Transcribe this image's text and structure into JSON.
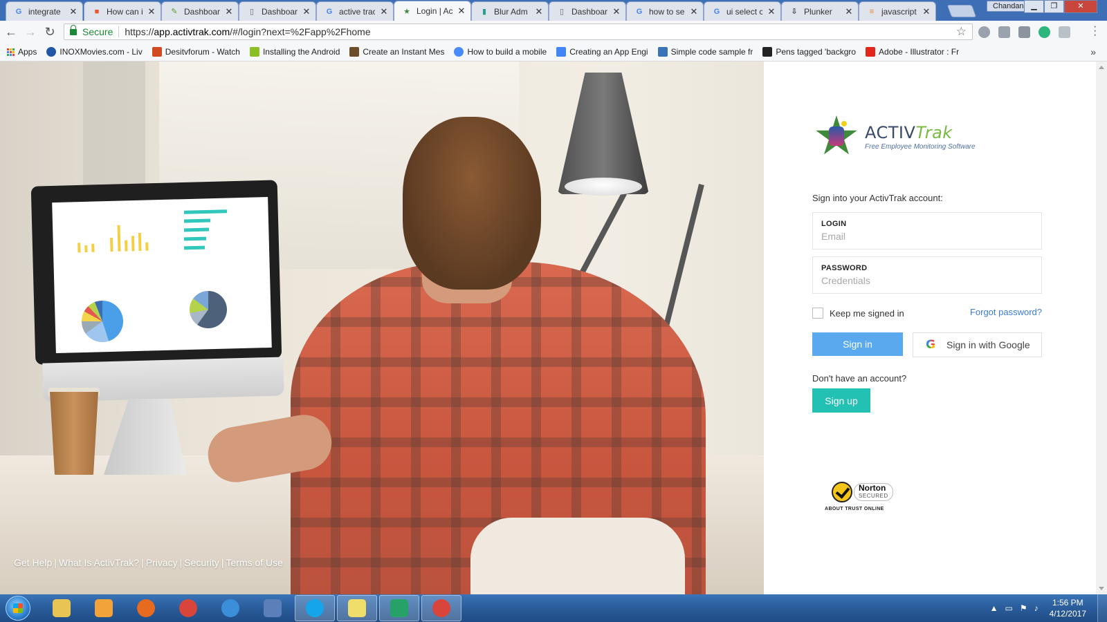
{
  "browser": {
    "tabs": [
      {
        "title": "integrate",
        "icon": "google-icon",
        "active": false
      },
      {
        "title": "How can i",
        "icon": "microsoft-icon",
        "active": false
      },
      {
        "title": "Dashboard",
        "icon": "leaf-icon",
        "active": false
      },
      {
        "title": "Dashboard",
        "icon": "page-icon",
        "active": false
      },
      {
        "title": "active trac",
        "icon": "google-icon",
        "active": false
      },
      {
        "title": "Login | Ac",
        "icon": "activtrak-icon",
        "active": true
      },
      {
        "title": "Blur Adm",
        "icon": "chart-icon",
        "active": false
      },
      {
        "title": "Dashboard",
        "icon": "page-icon",
        "active": false
      },
      {
        "title": "how to se",
        "icon": "google-icon",
        "active": false
      },
      {
        "title": "ui select c",
        "icon": "google-icon",
        "active": false
      },
      {
        "title": "Plunker",
        "icon": "plunker-icon",
        "active": false
      },
      {
        "title": "javascript",
        "icon": "stackoverflow-icon",
        "active": false
      }
    ],
    "close_glyph": "✕",
    "user": "Chandan",
    "window_controls": {
      "minimize": "▁",
      "maximize": "❐",
      "close": "✕"
    },
    "address": {
      "secure_label": "Secure",
      "url_scheme": "https://",
      "url_host": "app.activtrak.com",
      "url_path": "/#/login?next=%2Fapp%2Fhome"
    },
    "bookmarks": [
      {
        "label": "Apps",
        "icon": "apps-grid-icon"
      },
      {
        "label": "INOXMovies.com - Liv",
        "icon": "inox-icon"
      },
      {
        "label": "Desitvforum - Watch",
        "icon": "desitv-icon"
      },
      {
        "label": "Installing the Android",
        "icon": "android-icon"
      },
      {
        "label": "Create an Instant Mes",
        "icon": "bookmark-icon"
      },
      {
        "label": "How to build a mobile",
        "icon": "ionic-icon"
      },
      {
        "label": "Creating an App Engi",
        "icon": "appengine-icon"
      },
      {
        "label": "Simple code sample fr",
        "icon": "grid-icon"
      },
      {
        "label": "Pens tagged 'backgro",
        "icon": "codepen-icon"
      },
      {
        "label": "Adobe - Illustrator : Fr",
        "icon": "adobe-icon"
      }
    ],
    "bookmarks_more": "»"
  },
  "hero": {
    "footer_links": [
      "Get Help",
      "What Is ActivTrak?",
      "Privacy",
      "Security",
      "Terms of Use"
    ],
    "separator": "|"
  },
  "login": {
    "logo": {
      "word_a": "ACTIV",
      "word_b": "Trak",
      "tagline": "Free Employee  Monitoring Software"
    },
    "intro": "Sign into your ActivTrak account:",
    "login_label": "LOGIN",
    "login_placeholder": "Email",
    "password_label": "PASSWORD",
    "password_placeholder": "Credentials",
    "keep_signed_in": "Keep me signed in",
    "forgot_password": "Forgot password?",
    "sign_in": "Sign in",
    "sign_in_google": "Sign in with Google",
    "google_glyph": "G",
    "no_account": "Don't have an account?",
    "sign_up": "Sign up",
    "norton": {
      "name": "Norton",
      "secured": "SECURED",
      "trust": "ABOUT TRUST ONLINE"
    }
  },
  "taskbar": {
    "apps": [
      {
        "name": "explorer",
        "color": "#e8c455"
      },
      {
        "name": "media-player",
        "color": "#f2a33a"
      },
      {
        "name": "firefox",
        "color": "#e66a1f"
      },
      {
        "name": "chrome",
        "color": "#d9453b"
      },
      {
        "name": "internet-explorer",
        "color": "#3b8ed8"
      },
      {
        "name": "remote-desktop",
        "color": "#5b7fb8"
      },
      {
        "name": "skype",
        "color": "#14a6e8"
      },
      {
        "name": "sticky-notes",
        "color": "#f0de6a"
      },
      {
        "name": "visual-studio-code",
        "color": "#26a269"
      },
      {
        "name": "chrome-active",
        "color": "#d9453b"
      }
    ],
    "time": "1:56 PM",
    "date": "4/12/2017"
  },
  "colors": {
    "sign_in_button": "#5aa9ef",
    "sign_up_button": "#22c1b4",
    "link": "#3b7cd4",
    "secure_green": "#1a8a36"
  }
}
